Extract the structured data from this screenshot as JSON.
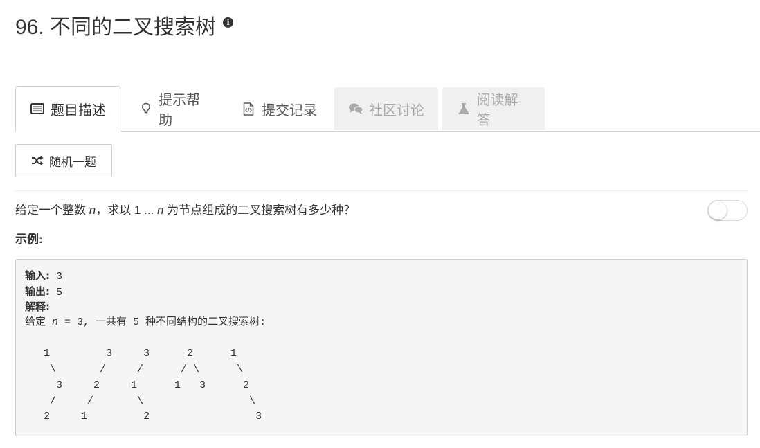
{
  "header": {
    "title": "96. 不同的二叉搜索树",
    "info_icon": "info-circle-icon"
  },
  "tabs": [
    {
      "label": "题目描述",
      "icon": "list-alt-icon",
      "state": "active"
    },
    {
      "label": "提示帮助",
      "icon": "lightbulb-icon",
      "state": "normal"
    },
    {
      "label": "提交记录",
      "icon": "code-file-icon",
      "state": "normal"
    },
    {
      "label": "社区讨论",
      "icon": "comments-icon",
      "state": "disabled"
    },
    {
      "label": "阅读解答",
      "icon": "flask-icon",
      "state": "disabled"
    }
  ],
  "random_button": {
    "label": "随机一题",
    "icon": "shuffle-icon"
  },
  "question": {
    "part1": "给定一个整数 ",
    "var_n": "n",
    "part2": "，求以 1 ... ",
    "var_n2": "n",
    "part3": " 为节点组成的二叉搜索树有多少种？"
  },
  "toggle": {
    "state": "off"
  },
  "example": {
    "label": "示例:",
    "input_label": "输入:",
    "input_value": " 3",
    "output_label": "输出:",
    "output_value": " 5",
    "explain_label": "解释:",
    "explain_prefix": "给定 ",
    "explain_n": "n",
    "explain_rest": " = 3, 一共有 5 种不同结构的二叉搜索树:",
    "tree_lines": [
      "",
      "   1         3     3      2      1",
      "    \\       /     /      / \\      \\",
      "     3     2     1      1   3      2",
      "    /     /       \\                 \\",
      "   2     1         2                 3"
    ]
  },
  "colors": {
    "text": "#333333",
    "border": "#cfcfcf",
    "disabled_tab_bg": "#f0f0f0",
    "code_bg": "#f5f5f5"
  }
}
